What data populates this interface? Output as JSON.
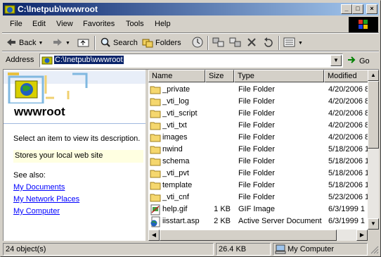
{
  "window": {
    "title": "C:\\Inetpub\\wwwroot",
    "controls": {
      "minimize": "_",
      "maximize": "□",
      "close": "×"
    }
  },
  "menu": [
    "File",
    "Edit",
    "View",
    "Favorites",
    "Tools",
    "Help"
  ],
  "toolbar": {
    "back": "Back",
    "search": "Search",
    "folders": "Folders"
  },
  "address": {
    "label": "Address",
    "value": "C:\\Inetpub\\wwwroot",
    "go": "Go"
  },
  "leftpane": {
    "folder_name": "wwwroot",
    "prompt": "Select an item to view its description.",
    "description": "Stores your local web site",
    "see_also": "See also:",
    "links": [
      "My Documents",
      "My Network Places",
      "My Computer"
    ]
  },
  "list": {
    "columns": [
      "Name",
      "Size",
      "Type",
      "Modified"
    ],
    "rows": [
      {
        "name": "_private",
        "size": "",
        "type": "File Folder",
        "modified": "4/20/2006 8",
        "icon": "folder-icon"
      },
      {
        "name": "_vti_log",
        "size": "",
        "type": "File Folder",
        "modified": "4/20/2006 8",
        "icon": "folder-icon"
      },
      {
        "name": "_vti_script",
        "size": "",
        "type": "File Folder",
        "modified": "4/20/2006 8",
        "icon": "folder-icon"
      },
      {
        "name": "_vti_txt",
        "size": "",
        "type": "File Folder",
        "modified": "4/20/2006 8",
        "icon": "folder-icon"
      },
      {
        "name": "images",
        "size": "",
        "type": "File Folder",
        "modified": "4/20/2006 8",
        "icon": "folder-icon"
      },
      {
        "name": "nwind",
        "size": "",
        "type": "File Folder",
        "modified": "5/18/2006 1",
        "icon": "folder-icon"
      },
      {
        "name": "schema",
        "size": "",
        "type": "File Folder",
        "modified": "5/18/2006 1",
        "icon": "folder-icon"
      },
      {
        "name": "_vti_pvt",
        "size": "",
        "type": "File Folder",
        "modified": "5/18/2006 1",
        "icon": "folder-icon"
      },
      {
        "name": "template",
        "size": "",
        "type": "File Folder",
        "modified": "5/18/2006 1",
        "icon": "folder-icon"
      },
      {
        "name": "_vti_cnf",
        "size": "",
        "type": "File Folder",
        "modified": "5/23/2006 1",
        "icon": "folder-icon"
      },
      {
        "name": "help.gif",
        "size": "1 KB",
        "type": "GIF Image",
        "modified": "6/3/1999 1",
        "icon": "image-file-icon"
      },
      {
        "name": "iisstart.asp",
        "size": "2 KB",
        "type": "Active Server Document",
        "modified": "6/3/1999 1",
        "icon": "asp-file-icon"
      }
    ]
  },
  "status": {
    "objects": "24 object(s)",
    "size": "26.4 KB",
    "zone": "My Computer"
  }
}
